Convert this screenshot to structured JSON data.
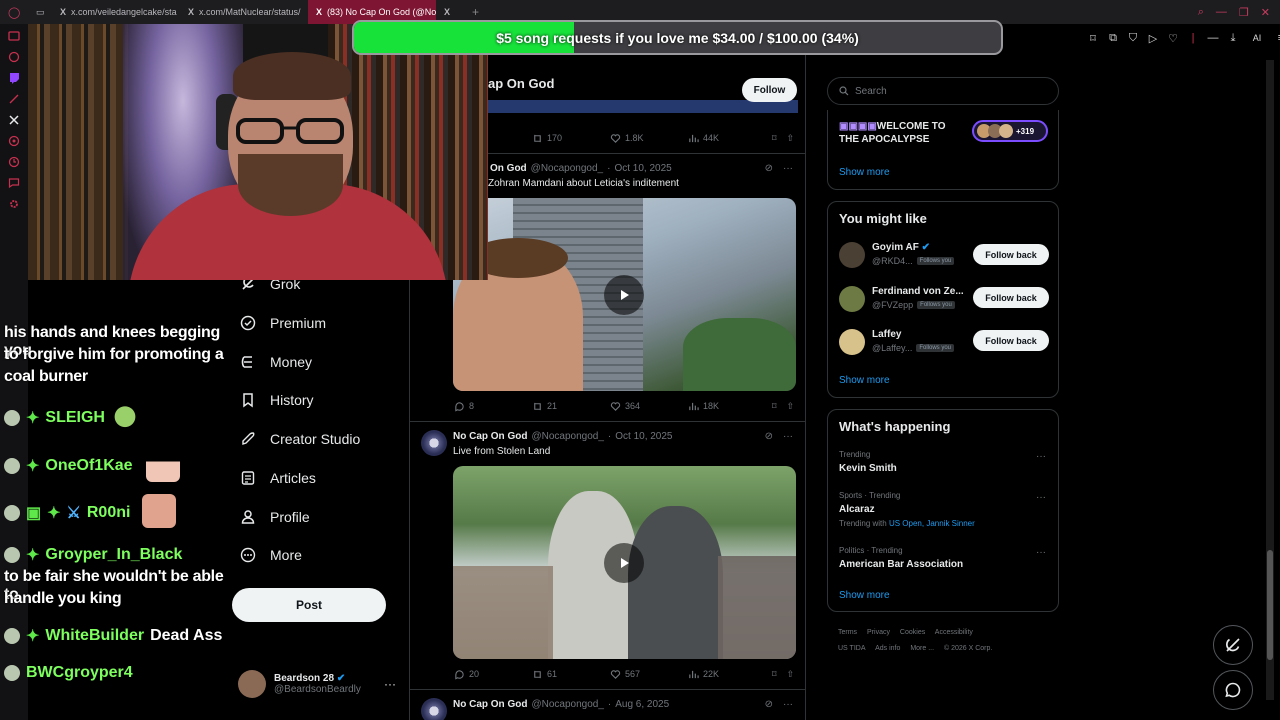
{
  "browser": {
    "tabs": [
      {
        "title": "x.com/veiledangelcake/sta"
      },
      {
        "title": "x.com/MatNuclear/status/"
      },
      {
        "title": "(83) No Cap On God (@No"
      },
      {
        "title": "X"
      }
    ],
    "toolbar_ai": "AI"
  },
  "donation": {
    "text": "$5 song requests if you love me $34.00 / $100.00 (34%)",
    "progress": 0.34
  },
  "chat": {
    "messages": [
      {
        "text": "his hands and knees begging you"
      },
      {
        "text": "to forgive him for promoting a"
      },
      {
        "text": "coal burner"
      },
      {
        "user": "SLEIGH",
        "msg": ""
      },
      {
        "user": "OneOf1Kae",
        "msg": ""
      },
      {
        "user": "R00ni",
        "msg": ""
      },
      {
        "user": "Groyper_In_Black",
        "msg": ""
      },
      {
        "text": "to be fair she wouldn't be able to"
      },
      {
        "text": "handle you king"
      },
      {
        "user": "WhiteBuilder",
        "msg": "Dead Ass"
      },
      {
        "user": "BWCgroyper4",
        "msg": ""
      }
    ]
  },
  "nav": {
    "items": [
      {
        "label": "Grok",
        "icon": "grok-icon"
      },
      {
        "label": "Premium",
        "icon": "premium-icon"
      },
      {
        "label": "Money",
        "icon": "money-icon"
      },
      {
        "label": "History",
        "icon": "bookmark-icon"
      },
      {
        "label": "Creator Studio",
        "icon": "rocket-icon"
      },
      {
        "label": "Articles",
        "icon": "articles-icon"
      },
      {
        "label": "Profile",
        "icon": "profile-icon"
      },
      {
        "label": "More",
        "icon": "more-icon"
      }
    ],
    "post_label": "Post",
    "account": {
      "name": "Beardson 28",
      "handle": "@BeardsonBeardly"
    }
  },
  "profile_header": {
    "name": "ap On God",
    "follow_label": "Follow"
  },
  "feed": {
    "tweets": [
      {
        "metrics": {
          "replies": "",
          "reposts": "170",
          "likes": "1.8K",
          "views": "44K"
        }
      },
      {
        "name": "On God",
        "handle": "@Nocapongod_",
        "date": "Oct 10, 2025",
        "text": "Zohran Mamdani about Leticia's inditement",
        "metrics": {
          "replies": "8",
          "reposts": "21",
          "likes": "364",
          "views": "18K"
        }
      },
      {
        "name": "No Cap On God",
        "handle": "@Nocapongod_",
        "date": "Oct 10, 2025",
        "text": "Live from Stolen Land",
        "metrics": {
          "replies": "20",
          "reposts": "61",
          "likes": "567",
          "views": "22K"
        }
      },
      {
        "name": "No Cap On God",
        "handle": "@Nocapongod_",
        "date": "Aug 6, 2025"
      }
    ]
  },
  "sidebar": {
    "search_placeholder": "Search",
    "community": {
      "title_line1": "WELCOME TO",
      "title_line2": "THE APOCALYPSE",
      "count": "+319",
      "show_more": "Show more"
    },
    "you_might_like": {
      "title": "You might like",
      "users": [
        {
          "name": "Goyim AF",
          "handle": "@RKD4...",
          "follows_you": "Follows you",
          "button": "Follow back"
        },
        {
          "name": "Ferdinand von Ze...",
          "handle": "@FVZepp",
          "follows_you": "Follows you",
          "button": "Follow back"
        },
        {
          "name": "Laffey",
          "handle": "@Laffey...",
          "follows_you": "Follows you",
          "button": "Follow back"
        }
      ],
      "show_more": "Show more"
    },
    "whats_happening": {
      "title": "What's happening",
      "trends": [
        {
          "context": "Trending",
          "name": "Kevin Smith",
          "with_prefix": "",
          "with": ""
        },
        {
          "context": "Sports · Trending",
          "name": "Alcaraz",
          "with_prefix": "Trending with",
          "with": "US Open, Jannik Sinner"
        },
        {
          "context": "Politics · Trending",
          "name": "American Bar Association",
          "with_prefix": "",
          "with": ""
        }
      ],
      "show_more": "Show more"
    },
    "footer": [
      "Terms",
      "Privacy",
      "Cookies",
      "Accessibility",
      "US TIDA",
      "Ads info",
      "More ...",
      "© 2026 X Corp."
    ]
  },
  "colors": {
    "accent": "#1d9bf0",
    "donation_fill": "#17e23a",
    "chat_name": "#7dff5e",
    "active_tab": "#7d1533"
  }
}
